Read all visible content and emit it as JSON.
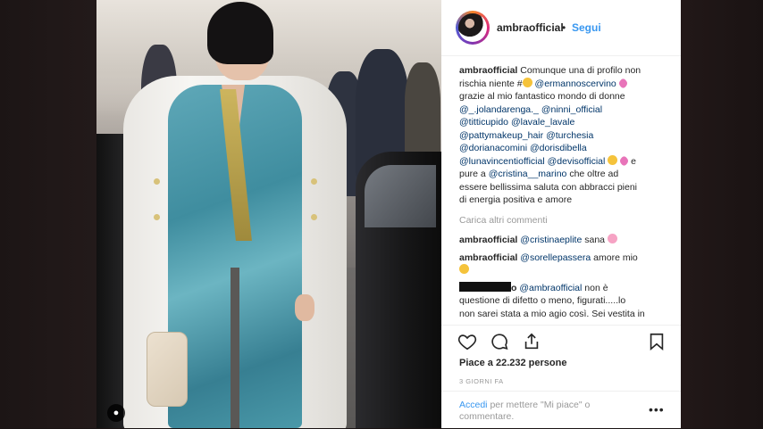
{
  "post": {
    "username": "ambraofficial",
    "dot": "•",
    "follow_label": "Segui",
    "caption_lines": [
      [
        "Comunque una di profilo non"
      ],
      [
        "rischia niente #"
      ],
      [
        "grazie al mio fantastico mondo di donne"
      ],
      [
        "@_.jolandarenga._",
        "@ninni_official"
      ],
      [
        "@titticupido",
        "@lavale_lavale"
      ],
      [
        "@pattymakeup_hair",
        "@turchesia"
      ],
      [
        "@dorianacomini",
        "@dorisdibella"
      ],
      [
        "@lunavincentiofficial",
        "@devisofficial"
      ],
      [
        "pure a",
        "@cristina__marino",
        "che oltre ad"
      ],
      [
        "essere bellissima saluta con abbracci pieni"
      ],
      [
        "di energia positiva e amore"
      ]
    ],
    "caption": {
      "line1_prefix": "Comunque una di profilo non",
      "line2_text": "rischia niente #",
      "line2_mention": "@ermannoscervino",
      "line3": "grazie al mio fantastico mondo di donne",
      "m1": "@_.jolandarenga._",
      "m2": "@ninni_official",
      "m3": "@titticupido",
      "m4": "@lavale_lavale",
      "m5": "@pattymakeup_hair",
      "m6": "@turchesia",
      "m7": "@dorianacomini",
      "m8": "@dorisdibella",
      "m9": "@lunavincentiofficial",
      "m10": "@devisofficial",
      "e_text": "e",
      "pure": "pure a",
      "m11": "@cristina__marino",
      "after": "che oltre ad",
      "line10": "essere bellissima saluta con abbracci pieni",
      "line11": "di energia positiva e amore"
    },
    "load_more_label": "Carica altri commenti",
    "comments": [
      {
        "user": "ambraofficial",
        "mention": "@cristinaeplite",
        "text": "sana"
      },
      {
        "user": "ambraofficial",
        "mention": "@sorellepassera",
        "text": "amore mio"
      },
      {
        "user_tail": "o",
        "mention": "@ambraofficial",
        "text_a": "non è",
        "text_b": "questione di difetto o meno, figurati.....lo",
        "text_c": "non sarei stata a mio agio così. Sei vestita in"
      }
    ],
    "likes_text": "Piace a 22.232 persone",
    "time_text": "3 GIORNI FA",
    "add_comment": {
      "link": "Accedi",
      "text": "per mettere \"Mi piace\" o commentare."
    },
    "more_options": "o o o",
    "icons": [
      "heart-icon",
      "comment-icon",
      "share-icon",
      "bookmark-icon",
      "user-tag-icon",
      "more-options-icon"
    ]
  }
}
